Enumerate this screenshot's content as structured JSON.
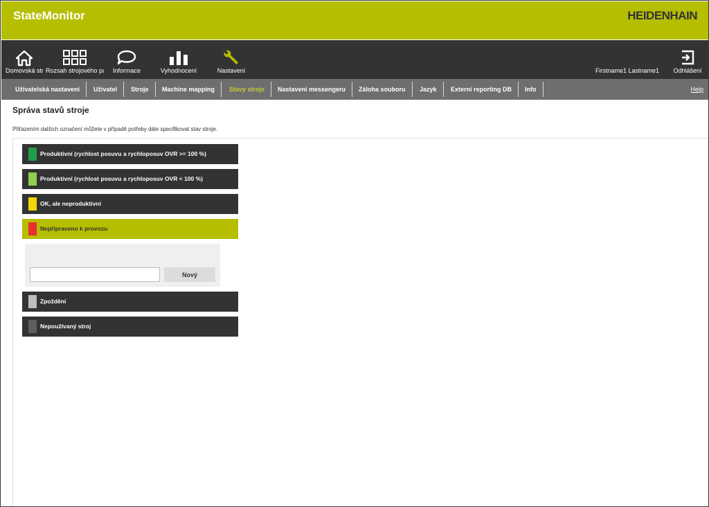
{
  "header": {
    "app_title": "StateMonitor",
    "brand": "HEIDENHAIN"
  },
  "topnav": {
    "items": [
      {
        "label": "Domovská stránka",
        "icon": "home-icon"
      },
      {
        "label": "Rozsah strojového parku",
        "icon": "grid-icon"
      },
      {
        "label": "Informace",
        "icon": "chat-bubble-icon"
      },
      {
        "label": "Vyhodnocení",
        "icon": "bar-chart-icon"
      },
      {
        "label": "Nastavení",
        "icon": "wrench-icon"
      }
    ],
    "user": "Firstname1 Lastname1",
    "logout": {
      "label": "Odhlášení",
      "icon": "logout-icon"
    }
  },
  "subnav": {
    "tabs": [
      "Uživatelská nastavení",
      "Uživatel",
      "Stroje",
      "Machine mapping",
      "Stavy stroje",
      "Nastavení messengeru",
      "Záloha souboru",
      "Jazyk",
      "Externí reporting DB",
      "Info"
    ],
    "active_tab": "Stavy stroje",
    "help": "Help"
  },
  "main": {
    "title": "Správa stavů stroje",
    "description": "Přiřazením dalších označení můžete v případě potřeby dále specifikovat stav stroje.",
    "states": [
      {
        "label": "Produktivní (rychlost posuvu a rychloposuv OVR >= 100 %)",
        "color": "#1f9e4a"
      },
      {
        "label": "Produktivní (rychlost posuvu a rychloposuv OVR < 100 %)",
        "color": "#8fd14f"
      },
      {
        "label": "OK, ale neproduktivní",
        "color": "#f2d80a"
      },
      {
        "label": "Nepřipraveno k provozu",
        "color": "#e8302e",
        "selected": true
      },
      {
        "label": "Zpoždění",
        "color": "#bdbdbd"
      },
      {
        "label": "Nepoužívaný stroj",
        "color": "#5e5e5e"
      }
    ],
    "new_entry": {
      "value": "",
      "button_label": "Nový"
    }
  },
  "colors": {
    "accent": "#b5be00",
    "dark": "#333333",
    "subnav": "#6e6e6e"
  }
}
